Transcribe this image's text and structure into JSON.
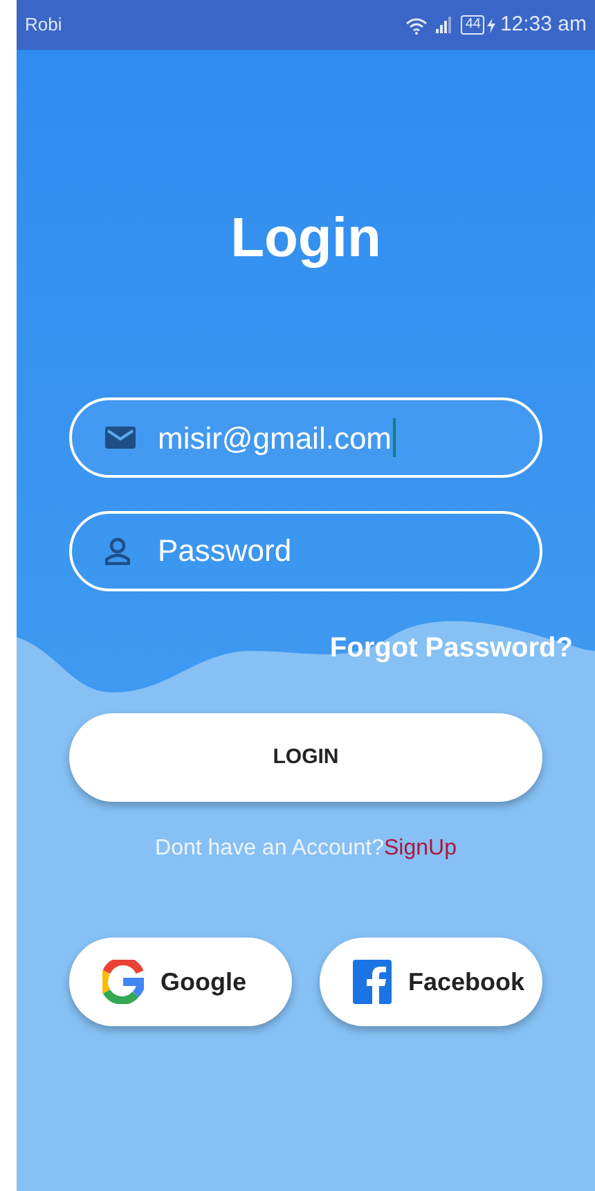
{
  "status_bar": {
    "carrier": "Robi",
    "battery": "44",
    "time": "12:33 am"
  },
  "title": "Login",
  "fields": [
    {
      "kind": "email",
      "value": "misir@gmail.com",
      "focused": true
    },
    {
      "kind": "password",
      "placeholder": "Password",
      "focused": false
    }
  ],
  "forgot_link": "Forgot Password?",
  "login_button": "LOGIN",
  "signup": {
    "prompt": "Dont have an Account?",
    "link": "SignUp"
  },
  "social_buttons": [
    {
      "kind": "google",
      "label": "Google"
    },
    {
      "kind": "facebook",
      "label": "Facebook"
    }
  ]
}
